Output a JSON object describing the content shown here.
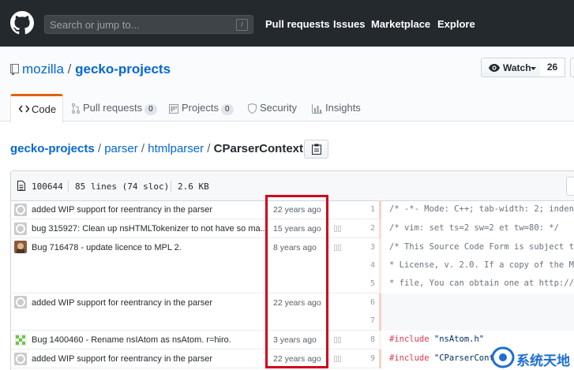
{
  "header": {
    "search_placeholder": "Search or jump to...",
    "slash_key": "/",
    "nav": [
      "Pull requests",
      "Issues",
      "Marketplace",
      "Explore"
    ]
  },
  "repo": {
    "owner": "mozilla",
    "separator": "/",
    "name": "gecko-projects",
    "watch_label": "Watch",
    "watch_count": "26"
  },
  "tabs": [
    {
      "label": "Code",
      "icon": "code-icon",
      "selected": true
    },
    {
      "label": "Pull requests",
      "icon": "pull-request-icon",
      "count": "0"
    },
    {
      "label": "Projects",
      "icon": "project-icon",
      "count": "0"
    },
    {
      "label": "Security",
      "icon": "shield-icon"
    },
    {
      "label": "Insights",
      "icon": "graph-icon"
    }
  ],
  "breadcrumb": {
    "root": "gecko-projects",
    "parts": [
      "parser",
      "htmlparser"
    ],
    "file": "CParserContext.cpp",
    "sep": "/"
  },
  "file_info": {
    "mode": "100644",
    "lines": "85 lines (74 sloc)",
    "size": "2.6 KB"
  },
  "blame": [
    {
      "message": "added WIP support for reentrancy in the parser",
      "age": "22 years ago",
      "avatar": "default-avatar",
      "lines": [
        "1"
      ]
    },
    {
      "message": "bug 315927: Clean up nsHTMLTokenizer to not have so ma...",
      "age": "15 years ago",
      "avatar": "default-avatar",
      "lines": [
        "2"
      ]
    },
    {
      "message": "Bug 716478 - update licence to MPL 2.",
      "age": "8 years ago",
      "avatar": "photo-avatar",
      "lines": [
        "3",
        "4",
        "5"
      ]
    },
    {
      "message": "added WIP support for reentrancy in the parser",
      "age": "22 years ago",
      "avatar": "default-avatar",
      "lines": [
        "6",
        "7"
      ]
    },
    {
      "message": "Bug 1400460 - Rename nsIAtom as nsAtom. r=hiro.",
      "age": "3 years ago",
      "avatar": "green-identicon",
      "lines": [
        "8"
      ]
    },
    {
      "message": "added WIP support for reentrancy in the parser",
      "age": "22 years ago",
      "avatar": "default-avatar",
      "lines": [
        "9"
      ]
    }
  ],
  "code": {
    "l1": "/* -*- Mode: C++; tab-width: 2; indent",
    "l2": "/* vim: set ts=2 sw=2 et tw=80: */",
    "l3": "/* This Source Code Form is subject to",
    "l4": " * License, v. 2.0. If a copy of the M",
    "l5": " * file, You can obtain one at http://",
    "l8_kw": "#include",
    "l8_str": "\"nsAtom.h\"",
    "l9_kw": "#include",
    "l9_str": "\"CParserCont"
  },
  "watermark": "系统天地",
  "colors": {
    "header_bg": "#24292e",
    "link": "#0366d6",
    "tab_accent": "#e36209",
    "highlight": "#d0021b"
  }
}
